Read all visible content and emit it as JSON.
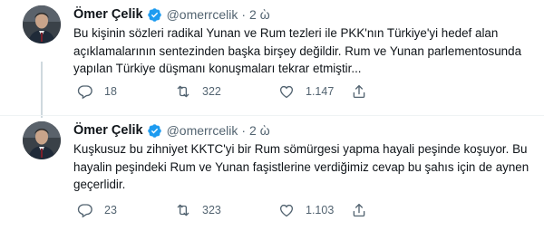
{
  "tweets": [
    {
      "author_name": "Ömer Çelik",
      "handle": "@omerrcelik",
      "separator": "·",
      "time": "2 ὼ",
      "text": "Bu kişinin sözleri radikal Yunan ve Rum tezleri ile PKK'nın Türkiye'yi hedef alan açıklamalarının sentezinden başka birşey değildir. Rum ve Yunan parlementosunda yapılan Türkiye düşmanı konuşmaları tekrar etmiştir...",
      "replies": "18",
      "retweets": "322",
      "likes": "1.147"
    },
    {
      "author_name": "Ömer Çelik",
      "handle": "@omerrcelik",
      "separator": "·",
      "time": "2 ὼ",
      "text": "Kuşkusuz bu zihniyet KKTC'yi bir Rum sömürgesi yapma hayali peşinde koşuyor. Bu hayalin peşindeki Rum ve Yunan faşistlerine verdiğimiz cevap bu şahıs için de aynen geçerlidir.",
      "replies": "23",
      "retweets": "323",
      "likes": "1.103"
    }
  ],
  "icons": {
    "verified": "verified-badge-icon",
    "reply": "reply-icon",
    "retweet": "retweet-icon",
    "like": "heart-icon",
    "share": "share-icon"
  },
  "colors": {
    "verified": "#1d9bf0",
    "secondary_text": "#536471",
    "thread_line": "#cfd9de"
  }
}
